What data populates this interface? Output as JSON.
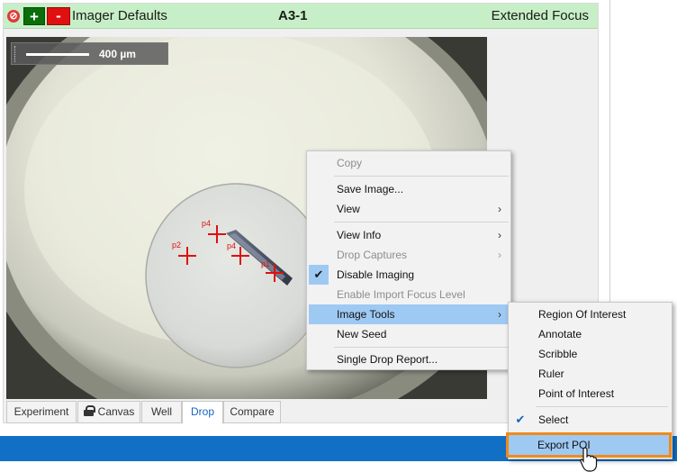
{
  "header": {
    "title": "Imager Defaults",
    "well": "A3-1",
    "mode": "Extended Focus",
    "plus_label": "+",
    "minus_label": "-"
  },
  "scale_bar": {
    "label": "400 µm"
  },
  "points_of_interest": [
    {
      "label": "p1"
    },
    {
      "label": "p2"
    },
    {
      "label": "p3"
    },
    {
      "label": "p4"
    }
  ],
  "tabs": [
    {
      "label": "Experiment"
    },
    {
      "label": "Canvas"
    },
    {
      "label": "Well"
    },
    {
      "label": "Drop",
      "active": true
    },
    {
      "label": "Compare"
    }
  ],
  "context_menu": {
    "items": [
      {
        "label": "Copy",
        "disabled": true
      },
      {
        "label": "Save Image..."
      },
      {
        "label": "View",
        "submenu": true
      },
      {
        "label": "View Info",
        "submenu": true
      },
      {
        "label": "Drop Captures",
        "submenu": true,
        "disabled": true
      },
      {
        "label": "Disable Imaging",
        "checked": true
      },
      {
        "label": "Enable Import Focus Level",
        "disabled": true
      },
      {
        "label": "Image Tools",
        "submenu": true,
        "highlighted": true
      },
      {
        "label": "New Seed"
      },
      {
        "label": "Single Drop Report..."
      }
    ]
  },
  "submenu": {
    "items": [
      {
        "label": "Region Of Interest"
      },
      {
        "label": "Annotate"
      },
      {
        "label": "Scribble"
      },
      {
        "label": "Ruler"
      },
      {
        "label": "Point of Interest"
      },
      {
        "label": "Select",
        "checked": true
      },
      {
        "label": "Export POI",
        "highlighted": true
      }
    ]
  },
  "colors": {
    "header_bg": "#c7efc7",
    "accent_blue": "#1170c6",
    "highlight": "#9ec9f3",
    "export_outline": "#f08a1a",
    "poi_marker": "#e01010"
  }
}
